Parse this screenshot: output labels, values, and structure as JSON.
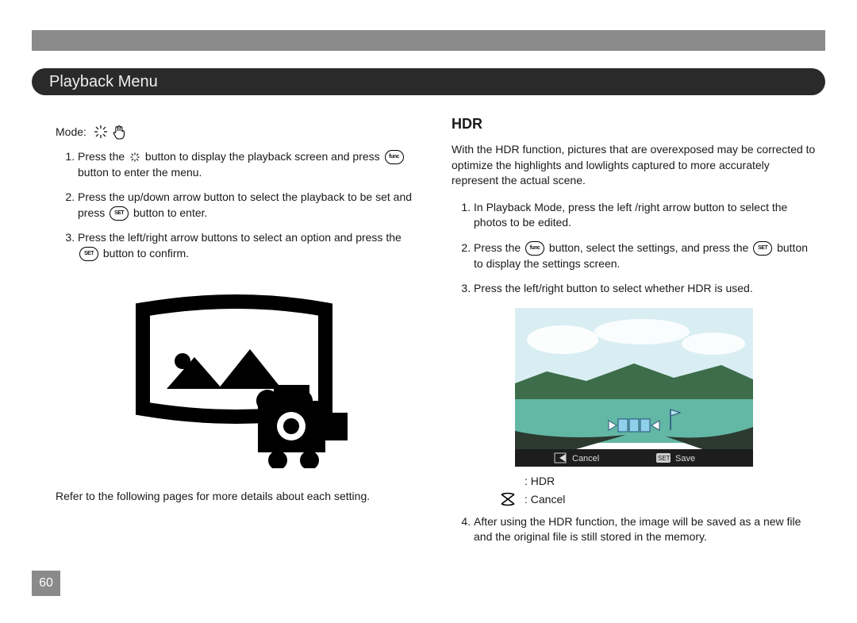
{
  "page_number": "60",
  "title": "Playback Menu",
  "left": {
    "mode_label": "Mode:",
    "steps": [
      {
        "pre": "Press the ",
        "mid": " button to display the playback screen and press ",
        "post": " button to enter the menu."
      },
      {
        "pre": "Press the up/down arrow button to select the playback to be set and press ",
        "post": " button to enter."
      },
      {
        "pre": "Press the left/right arrow buttons to select an option and press the ",
        "post": " button to confirm."
      }
    ],
    "footer": "Refer to the following pages for more details about each setting."
  },
  "right": {
    "heading": "HDR",
    "intro": "With the HDR function, pictures that are overexposed may be corrected to optimize the highlights and lowlights captured to more accurately represent the actual scene.",
    "steps": [
      "In Playback Mode, press the left /right arrow button to select the photos to be edited.",
      {
        "pre": "Press the ",
        "mid": " button, select the        settings, and press the ",
        "post": " button to display the settings screen."
      },
      "Press the left/right button to select whether HDR is used."
    ],
    "preview_bar": {
      "cancel": "Cancel",
      "save": "Save"
    },
    "legend_hdr": ": HDR",
    "legend_cancel": ": Cancel",
    "step4": "After using the HDR function, the image will be saved as a new file and the original file is still stored in the memory."
  }
}
